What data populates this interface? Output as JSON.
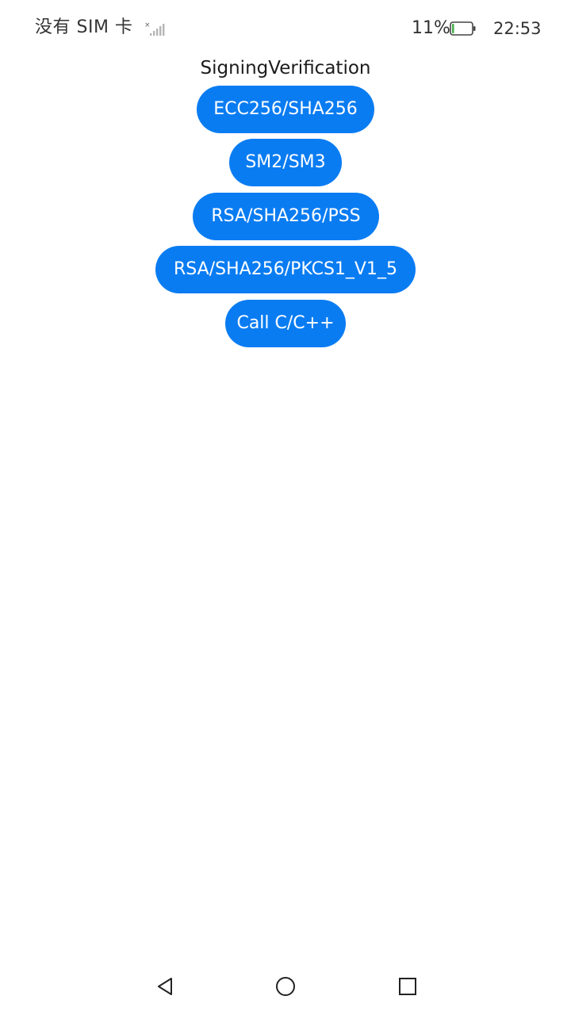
{
  "status_bar": {
    "carrier": "没有 SIM 卡",
    "battery_percent": "11%",
    "battery_level": 0.11,
    "time": "22:53",
    "icons": {
      "signal": "no-signal-icon",
      "battery": "battery-icon"
    }
  },
  "main": {
    "title": "SigningVerification",
    "buttons": [
      {
        "label": "ECC256/SHA256"
      },
      {
        "label": "SM2/SM3"
      },
      {
        "label": "RSA/SHA256/PSS"
      },
      {
        "label": "RSA/SHA256/PKCS1_V1_5"
      },
      {
        "label": "Call C/C++"
      }
    ]
  },
  "nav_bar": {
    "icons": [
      "back-triangle-icon",
      "home-circle-icon",
      "recents-square-icon"
    ]
  },
  "colors": {
    "accent": "#0a7cf2",
    "background": "#ffffff",
    "battery_low": "#4caf50"
  }
}
